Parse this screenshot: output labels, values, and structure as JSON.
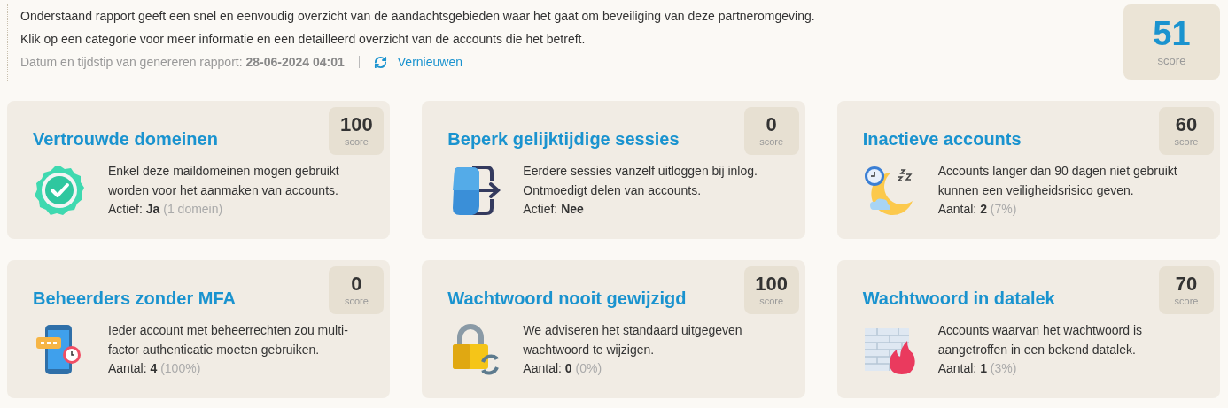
{
  "intro": {
    "lines": [
      "Onderstaand rapport geeft een snel en eenvoudig overzicht van de aandachtsgebieden waar het gaat om beveiliging van deze partneromgeving.",
      "Klik op een categorie voor meer informatie en een detailleerd overzicht van de accounts die het betreft."
    ],
    "generated_label": "Datum en tijdstip van genereren rapport:",
    "generated_value": "28-06-2024 04:01",
    "refresh": "Vernieuwen"
  },
  "total": {
    "value": "51",
    "label": "score"
  },
  "cards": [
    {
      "kind": "badge",
      "title": "Vertrouwde domeinen",
      "score": "100",
      "score_label": "score",
      "description": "Enkel deze maildomeinen mogen gebruikt worden voor het aanmaken van accounts.",
      "stat_label": "Actief:",
      "stat_value": "Ja",
      "stat_note": "(1 domein)"
    },
    {
      "kind": "logout",
      "title": "Beperk gelijktijdige sessies",
      "score": "0",
      "score_label": "score",
      "description": "Eerdere sessies vanzelf uitloggen bij inlog. Ontmoedigt delen van accounts.",
      "stat_label": "Actief:",
      "stat_value": "Nee"
    },
    {
      "kind": "sleep",
      "title": "Inactieve accounts",
      "score": "60",
      "score_label": "score",
      "description": "Accounts langer dan 90 dagen niet gebruikt kunnen een veiligheidsrisico geven.",
      "stat_label": "Aantal:",
      "stat_value": "2",
      "stat_note": "(7%)"
    },
    {
      "kind": "phone",
      "title": "Beheerders zonder MFA",
      "score": "0",
      "score_label": "score",
      "description": "Ieder account met beheerrechten zou multi-factor authenticatie moeten gebruiken.",
      "stat_label": "Aantal:",
      "stat_value": "4",
      "stat_note": "(100%)"
    },
    {
      "kind": "lock",
      "title": "Wachtwoord nooit gewijzigd",
      "score": "100",
      "score_label": "score",
      "description": "We adviseren het standaard uitgegeven wachtwoord te wijzigen.",
      "stat_label": "Aantal:",
      "stat_value": "0",
      "stat_note": "(0%)"
    },
    {
      "kind": "firewall",
      "title": "Wachtwoord in datalek",
      "score": "70",
      "score_label": "score",
      "description": "Accounts waarvan het wachtwoord is aangetroffen in een bekend datalek.",
      "stat_label": "Aantal:",
      "stat_value": "1",
      "stat_note": "(3%)"
    }
  ]
}
